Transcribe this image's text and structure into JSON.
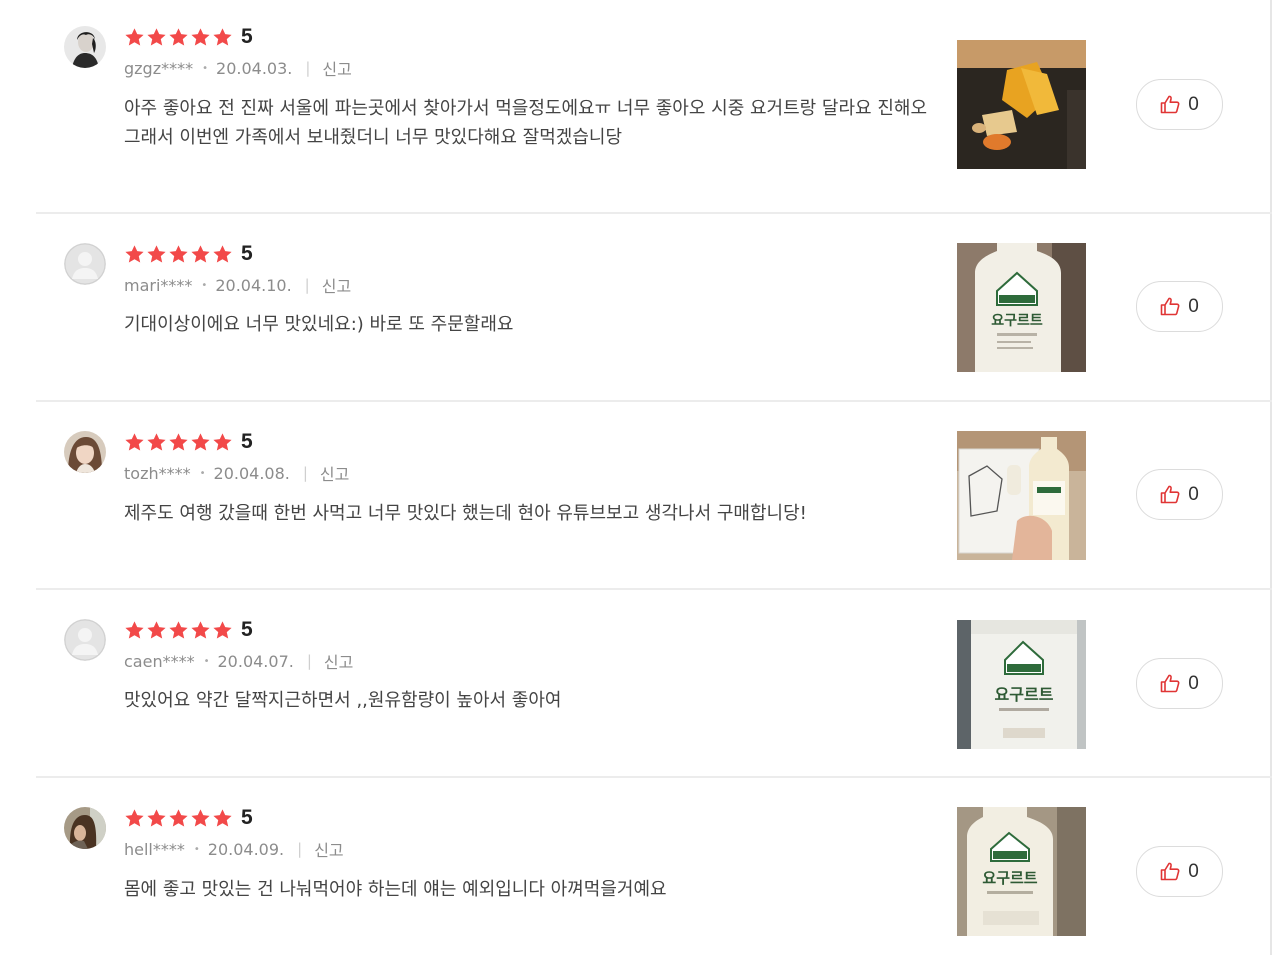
{
  "reviews": [
    {
      "score": "5",
      "rating": 5,
      "username": "gzgz****",
      "date": "20.04.03.",
      "report_label": "신고",
      "text_lines": [
        "아주 좋아요 전 진짜 서울에 파는곳에서 찾아가서 먹을정도에요ㅠ 너무 좋아오 시중 요거트랑 달라요 진해오",
        "그래서 이번엔 가족에서 보내줬더니 너무 맛있다해요 잘먹겠습니당"
      ],
      "likes": "0",
      "avatar": "woman-profile-bw",
      "photo": "cheese-board"
    },
    {
      "score": "5",
      "rating": 5,
      "username": "mari****",
      "date": "20.04.10.",
      "report_label": "신고",
      "text_lines": [
        "기대이상이에요 너무 맛있네요:) 바로  또 주문할래요"
      ],
      "likes": "0",
      "avatar": "default-user",
      "photo": "yogurt-bottle"
    },
    {
      "score": "5",
      "rating": 5,
      "username": "tozh****",
      "date": "20.04.08.",
      "report_label": "신고",
      "text_lines": [
        "제주도 여행 갔을때 한번 사먹고 너무 맛있다 했는데 현아 유튜브보고 생각나서 구매합니당!"
      ],
      "likes": "0",
      "avatar": "woman-profile-color",
      "photo": "yogurt-in-hand"
    },
    {
      "score": "5",
      "rating": 5,
      "username": "caen****",
      "date": "20.04.07.",
      "report_label": "신고",
      "text_lines": [
        "맛있어요 약간 달짝지근하면서 ,,원유함량이 높아서 좋아여"
      ],
      "likes": "0",
      "avatar": "default-user",
      "photo": "yogurt-bottle-closeup"
    },
    {
      "score": "5",
      "rating": 5,
      "username": "hell****",
      "date": "20.04.09.",
      "report_label": "신고",
      "text_lines": [
        "몸에 좋고 맛있는 건 나눠먹어야 하는데 얘는 예외입니다 아껴먹을거예요"
      ],
      "likes": "0",
      "avatar": "person-photo",
      "photo": "yogurt-bottle-label"
    }
  ],
  "bottle_label_text": "요구르트",
  "colors": {
    "star": "#f24949",
    "like_icon": "#e03535",
    "divider": "#ececec",
    "meta": "#8c8c8c"
  }
}
